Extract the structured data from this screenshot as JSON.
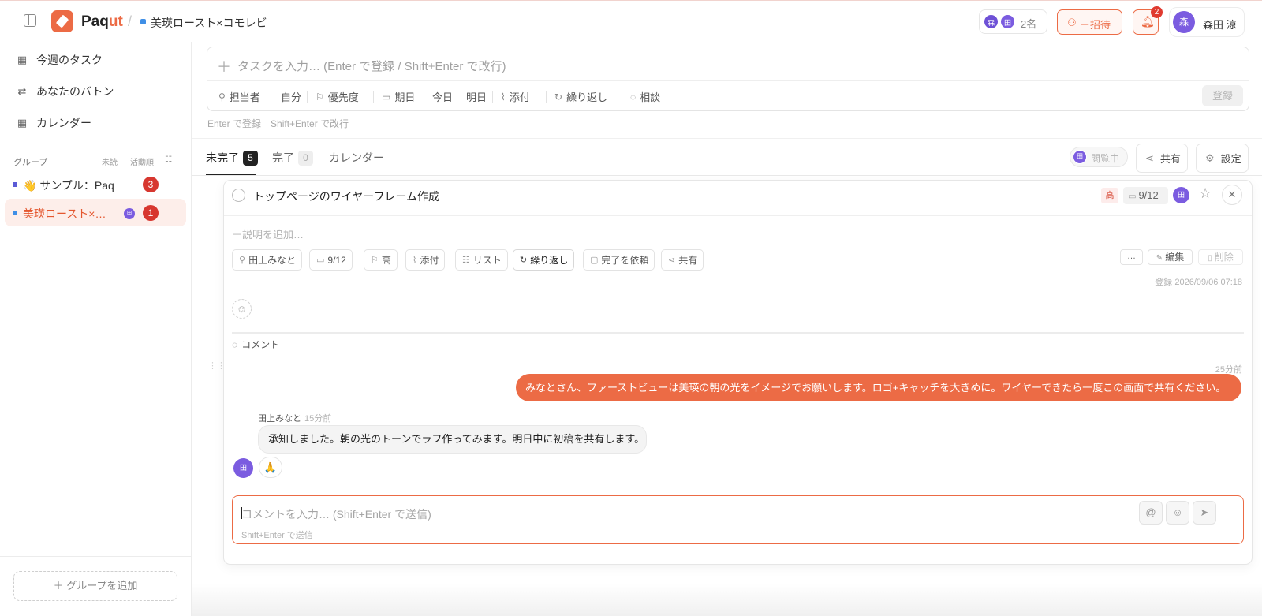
{
  "app": {
    "brand_main": "Paq",
    "brand_accent": "ut",
    "accent_color": "#ec6b45"
  },
  "header": {
    "breadcrumb": "美瑛ロースト×コモレビ",
    "members_avatars": [
      "森",
      "田"
    ],
    "members_count": "2名",
    "invite_label": "＋招待",
    "notification_count": "2",
    "user_initial": "森",
    "user_name": "森田 涼"
  },
  "sidebar": {
    "nav": [
      {
        "label": "今週のタスク",
        "icon": "calendar-icon"
      },
      {
        "label": "あなたのバトン",
        "icon": "swap-icon"
      },
      {
        "label": "カレンダー",
        "icon": "calendar-icon"
      }
    ],
    "groups_title": "グループ",
    "sort_unread": "未読",
    "sort_activity": "活動順",
    "groups": [
      {
        "label": "👋 サンプル：Paqu…",
        "badge": "3",
        "dot_color": "#5b5bd6"
      },
      {
        "label": "美瑛ロースト×…",
        "badge": "1",
        "avatar": "田",
        "dot_color": "#3f8fe6"
      }
    ],
    "add_group": "＋ グループを追加"
  },
  "task_input": {
    "placeholder": "タスクを入力… (Enter で登録 / Shift+Enter で改行)",
    "assignee": "担当者",
    "self": "自分",
    "priority": "優先度",
    "due": "期日",
    "today": "今日",
    "tomorrow": "明日",
    "attach": "添付",
    "repeat": "繰り返し",
    "consult": "相談",
    "register": "登録",
    "hint": "Enter で登録　Shift+Enter で改行"
  },
  "tabs": [
    {
      "label": "未完了",
      "count": "5"
    },
    {
      "label": "完了",
      "count": "0"
    },
    {
      "label": "カレンダー"
    }
  ],
  "view_actions": {
    "viewing": "閲覧中",
    "viewing_avatar": "田",
    "share": "共有",
    "settings": "設定"
  },
  "task": {
    "title": "トップページのワイヤーフレーム作成",
    "priority_tag": "高",
    "due_tag": "9/12",
    "assignee_avatar": "田",
    "description_placeholder": "＋説明を追加…",
    "chips": {
      "assignee": "田上みなと",
      "due": "9/12",
      "priority": "高",
      "attach": "添付",
      "list": "リスト",
      "repeat": "繰り返し",
      "request_done": "完了を依頼",
      "share": "共有"
    },
    "more": "…",
    "edit": "編集",
    "delete": "削除",
    "registered": "登録 2026/09/06 07:18"
  },
  "comments": {
    "header": "コメント",
    "items": [
      {
        "time": "25分前",
        "text": "みなとさん、ファーストビューは美瑛の朝の光をイメージでお願いします。ロゴ+キャッチを大きめに。ワイヤーできたら一度この画面で共有ください。"
      },
      {
        "author": "田上みなと",
        "time": "15分前",
        "text": "承知しました。朝の光のトーンでラフ作ってみます。明日中に初稿を共有します。",
        "avatar": "田",
        "reaction": "🙏"
      }
    ],
    "input_placeholder": "コメントを入力… (Shift+Enter で送信)",
    "input_hint": "Shift+Enter で送信",
    "mention": "@"
  }
}
